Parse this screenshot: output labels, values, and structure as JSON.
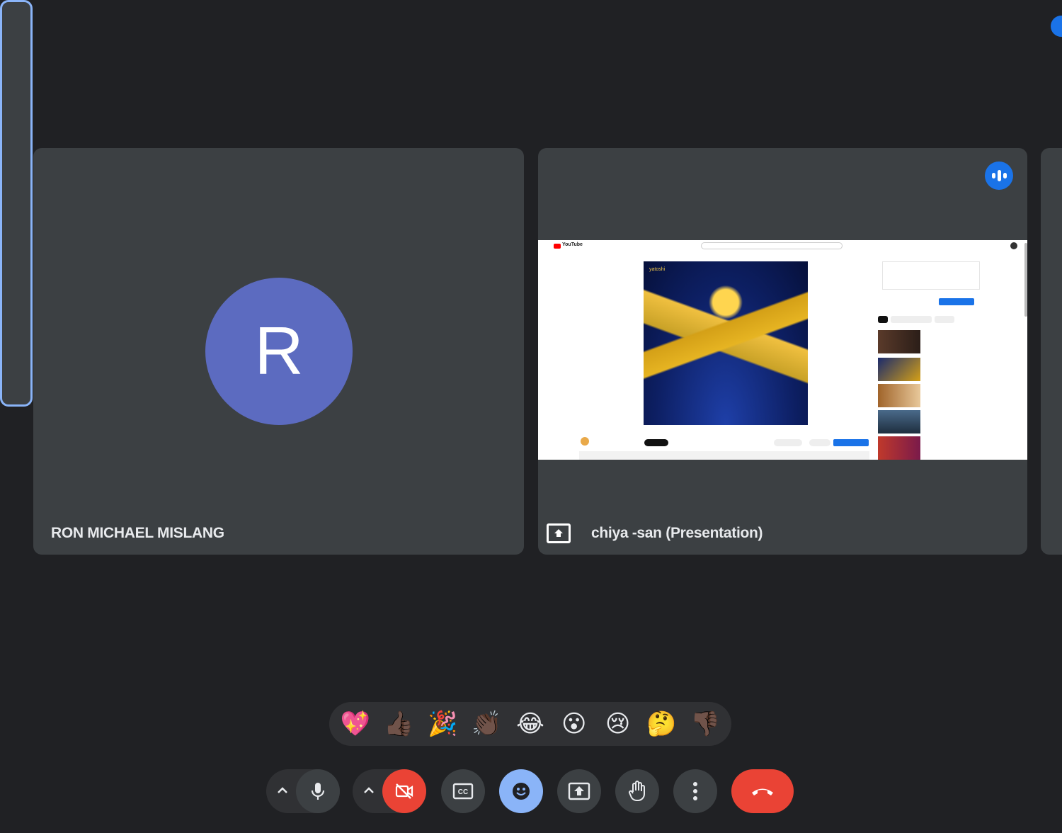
{
  "participants": [
    {
      "name": "RON MICHAEL MISLANG",
      "avatar_initial": "R",
      "avatar_color": "#5c6bc0"
    },
    {
      "name": "chiya -san (Presentation)",
      "speaking": true
    }
  ],
  "shared_screen": {
    "site": "YouTube",
    "art_label": "yatoshi"
  },
  "reactions": [
    "💖",
    "👍🏿",
    "🎉",
    "👏🏿",
    "😂",
    "😮",
    "😢",
    "🤔",
    "👎🏿"
  ],
  "controls": {
    "mic": "mic-on",
    "camera": "camera-off",
    "captions": "CC",
    "end_call_color": "#ea4335",
    "camera_off_color": "#ea4335",
    "emoji_active_color": "#8ab4f8"
  }
}
